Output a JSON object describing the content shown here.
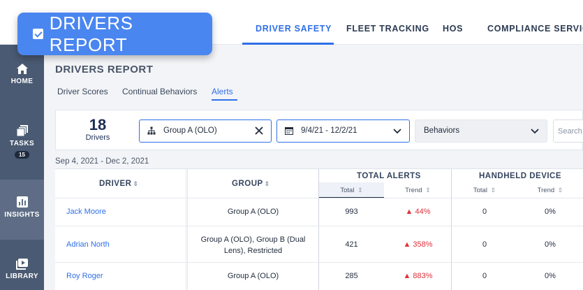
{
  "title_badge": {
    "text": "DRIVERS REPORT",
    "icon": "checkbox-icon"
  },
  "topnav": {
    "tabs": [
      {
        "label": "DRIVER SAFETY",
        "active": true
      },
      {
        "label": "FLEET TRACKING",
        "active": false
      },
      {
        "label": "HOS",
        "active": false
      },
      {
        "label": "COMPLIANCE SERVICES",
        "active": false
      }
    ]
  },
  "sidebar": {
    "items": [
      {
        "label": "HOME",
        "icon": "home-icon"
      },
      {
        "label": "TASKS",
        "icon": "tasks-icon",
        "badge": "15"
      },
      {
        "label": "INSIGHTS",
        "icon": "insights-icon",
        "active": true
      },
      {
        "label": "LIBRARY",
        "icon": "library-icon"
      }
    ]
  },
  "page": {
    "title": "DRIVERS REPORT",
    "subtabs": [
      {
        "label": "Driver Scores",
        "active": false
      },
      {
        "label": "Continual Behaviors",
        "active": false
      },
      {
        "label": "Alerts",
        "active": true
      }
    ]
  },
  "filters": {
    "count": "18",
    "count_label": "Drivers",
    "group": "Group A (OLO)",
    "date": "9/4/21 - 12/2/21",
    "behaviors": "Behaviors",
    "search_placeholder": "Search D"
  },
  "date_range": "Sep 4, 2021 - Dec 2, 2021",
  "table": {
    "headers": {
      "driver": "DRIVER",
      "group": "GROUP",
      "total_alerts": "TOTAL ALERTS",
      "handheld": "HANDHELD DEVICE"
    },
    "subheaders": {
      "total": "Total",
      "trend": "Trend"
    },
    "rows": [
      {
        "driver": "Jack Moore",
        "group": "Group A (OLO)",
        "total": "993",
        "trend": "44%",
        "hh_total": "0",
        "hh_trend": "0%"
      },
      {
        "driver": "Adrian North",
        "group": "Group A (OLO), Group B (Dual Lens), Restricted",
        "total": "421",
        "trend": "358%",
        "hh_total": "0",
        "hh_trend": "0%"
      },
      {
        "driver": "Roy Roger",
        "group": "Group A (OLO)",
        "total": "285",
        "trend": "883%",
        "hh_total": "0",
        "hh_trend": "0%"
      }
    ]
  },
  "colors": {
    "accent": "#2f6fe8",
    "sidebar": "#4a5a72",
    "trend_up": "#e0303a",
    "badge": "#4a86f0"
  }
}
